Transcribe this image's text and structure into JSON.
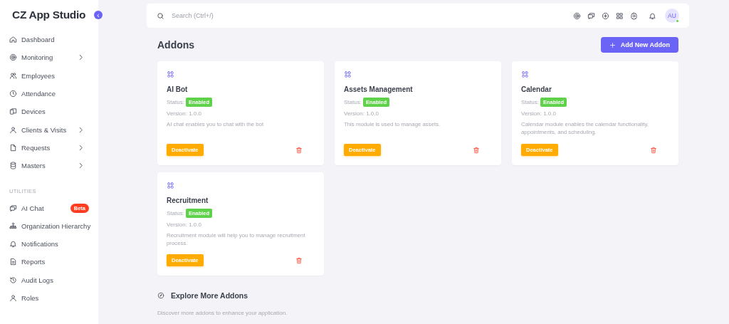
{
  "sidebar": {
    "title": "CZ App Studio",
    "collapse_button": "‹",
    "items": [
      {
        "label": "Dashboard",
        "expandable": false
      },
      {
        "label": "Monitoring",
        "expandable": true
      },
      {
        "label": "Employees",
        "expandable": false
      },
      {
        "label": "Attendance",
        "expandable": false
      },
      {
        "label": "Devices",
        "expandable": false
      },
      {
        "label": "Clients & Visits",
        "expandable": true
      },
      {
        "label": "Requests",
        "expandable": true
      },
      {
        "label": "Masters",
        "expandable": true
      }
    ],
    "section_label": "UTILITIES",
    "utility_items": [
      {
        "label": "AI Chat",
        "badge": "Beta"
      },
      {
        "label": "Organization Hierarchy"
      },
      {
        "label": "Notifications"
      },
      {
        "label": "Reports"
      },
      {
        "label": "Audit Logs"
      },
      {
        "label": "Roles"
      }
    ]
  },
  "topbar": {
    "search": {
      "placeholder": "Search (Ctrl+/)"
    },
    "avatar": {
      "initials": "AU",
      "online": true
    }
  },
  "page": {
    "title": "Addons",
    "add_button": "Add New Addon"
  },
  "addons": [
    {
      "name": "AI Bot",
      "status_label": "Status:",
      "status": "Enabled",
      "version": "Version: 1.0.0",
      "description": "AI chat enables you to chat with the bot",
      "action": "Deactivate"
    },
    {
      "name": "Assets Management",
      "status_label": "Status:",
      "status": "Enabled",
      "version": "Version: 1.0.0",
      "description": "This module is used to manage assets.",
      "action": "Deactivate"
    },
    {
      "name": "Calendar",
      "status_label": "Status:",
      "status": "Enabled",
      "version": "Version: 1.0.0",
      "description": "Calendar module enables the calendar functionality, appointments, and scheduling.",
      "action": "Deactivate"
    },
    {
      "name": "Recruitment",
      "status_label": "Status:",
      "status": "Enabled",
      "version": "Version: 1.0.0",
      "description": "Recruitment module will help you to manage recruitment process.",
      "action": "Deactivate"
    }
  ],
  "explore": {
    "title": "Explore More Addons",
    "subtitle": "Discover more addons to enhance your application."
  }
}
